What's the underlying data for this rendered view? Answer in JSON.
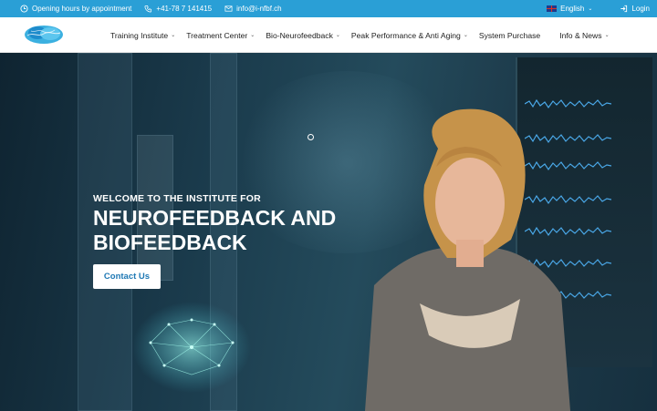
{
  "topbar": {
    "hours": "Opening hours by appointment",
    "phone": "+41-78 7 141415",
    "email": "info@i-nfbf.ch",
    "language": "English",
    "login": "Login"
  },
  "nav": {
    "items": [
      {
        "label": "Training Institute",
        "has_dropdown": true
      },
      {
        "label": "Treatment Center",
        "has_dropdown": true
      },
      {
        "label": "Bio-Neurofeedback",
        "has_dropdown": true
      },
      {
        "label": "Peak Performance & Anti Aging",
        "has_dropdown": true
      },
      {
        "label": "System Purchase",
        "has_dropdown": false
      },
      {
        "label": "Info & News",
        "has_dropdown": true
      }
    ]
  },
  "hero": {
    "subtitle": "WELCOME TO THE INSTITUTE FOR",
    "title": "NEUROFEEDBACK AND BIOFEEDBACK",
    "cta": "Contact Us"
  },
  "icons": {
    "clock": "clock-icon",
    "phone": "phone-icon",
    "mail": "mail-icon",
    "flag": "uk-flag-icon",
    "login": "login-icon",
    "chevron": "chevron-down-icon"
  },
  "colors": {
    "topbar": "#2a9fd6",
    "cta_text": "#1e78b4"
  }
}
